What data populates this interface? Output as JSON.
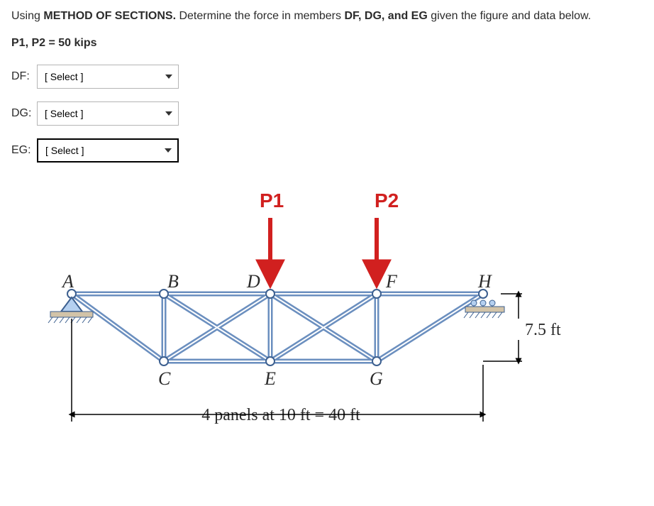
{
  "prompt": {
    "p1_a": "Using ",
    "p1_b": "METHOD OF SECTIONS.",
    "p1_c": " Determine the force in members ",
    "p1_d": "DF, DG, and EG",
    "p1_e": " given the figure and data below."
  },
  "given": "P1, P2 = 50 kips",
  "selectors": {
    "df_label": "DF:",
    "dg_label": "DG:",
    "eg_label": "EG:",
    "placeholder": "[ Select ]"
  },
  "nodes": {
    "A": "A",
    "B": "B",
    "C": "C",
    "D": "D",
    "E": "E",
    "F": "F",
    "G": "G",
    "H": "H"
  },
  "loads": {
    "P1": "P1",
    "P2": "P2"
  },
  "dims": {
    "height": "7.5 ft",
    "panels": "4 panels at 10 ft = 40 ft"
  },
  "chart_data": {
    "type": "diagram",
    "truss_type": "Pratt/Warren hybrid truss",
    "top_chord_nodes": [
      "A",
      "B",
      "D",
      "F",
      "H"
    ],
    "bottom_chord_nodes": [
      "C",
      "E",
      "G"
    ],
    "panel_length_ft": 10,
    "panel_count": 4,
    "span_ft": 40,
    "depth_ft": 7.5,
    "loads": [
      {
        "node": "D",
        "name": "P1",
        "value_kips": 50,
        "direction": "down"
      },
      {
        "node": "F",
        "name": "P2",
        "value_kips": 50,
        "direction": "down"
      }
    ],
    "supports": [
      {
        "node": "A",
        "type": "pin"
      },
      {
        "node": "H",
        "type": "roller"
      }
    ],
    "members_asked": [
      "DF",
      "DG",
      "EG"
    ],
    "method": "Method of Sections"
  }
}
